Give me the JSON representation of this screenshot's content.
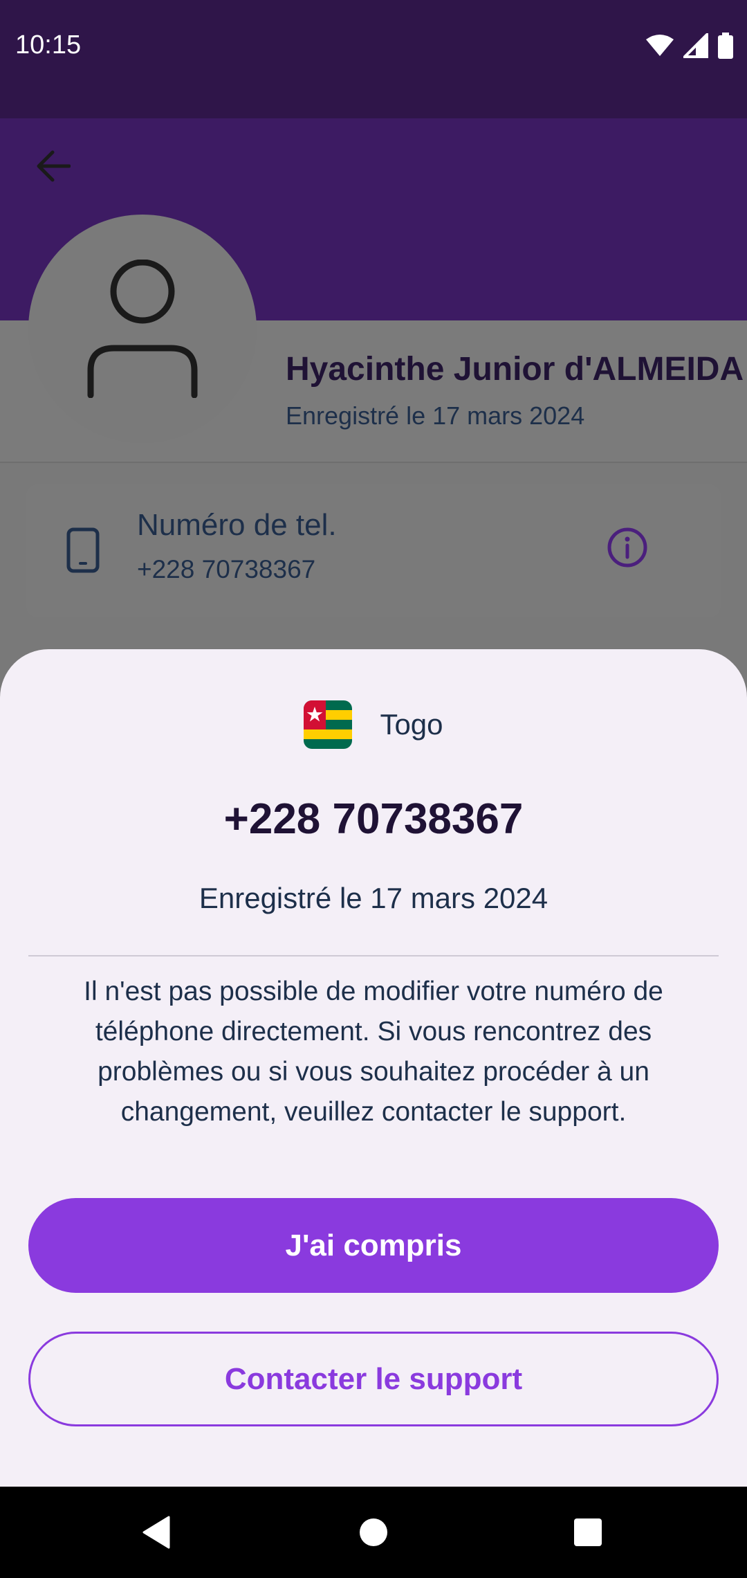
{
  "status_bar": {
    "time": "10:15"
  },
  "profile": {
    "name": "Hyacinthe Junior  d'ALMEIDA",
    "registered": "Enregistré le 17 mars 2024"
  },
  "phone_card": {
    "label": "Numéro de tel.",
    "number": "+228 70738367"
  },
  "sheet": {
    "country": "Togo",
    "number": "+228 70738367",
    "registered": "Enregistré le 17 mars 2024",
    "message": "Il n'est pas possible de modifier votre numéro de téléphone directement. Si vous rencontrez des problèmes ou si vous souhaitez procéder à un changement, veuillez contacter le support.",
    "primary_button": "J'ai compris",
    "secondary_button": "Contacter le support"
  },
  "colors": {
    "header": "#3d1b63",
    "status_bar": "#2f1549",
    "accent": "#8a3ade",
    "sheet_background": "#f4eff7",
    "text_primary": "#1f1235",
    "text_secondary": "#1d2f4a"
  },
  "icons": {
    "back": "arrow-left-icon",
    "avatar": "person-icon",
    "phone": "smartphone-icon",
    "info": "info-icon",
    "flag": "togo-flag-icon"
  }
}
